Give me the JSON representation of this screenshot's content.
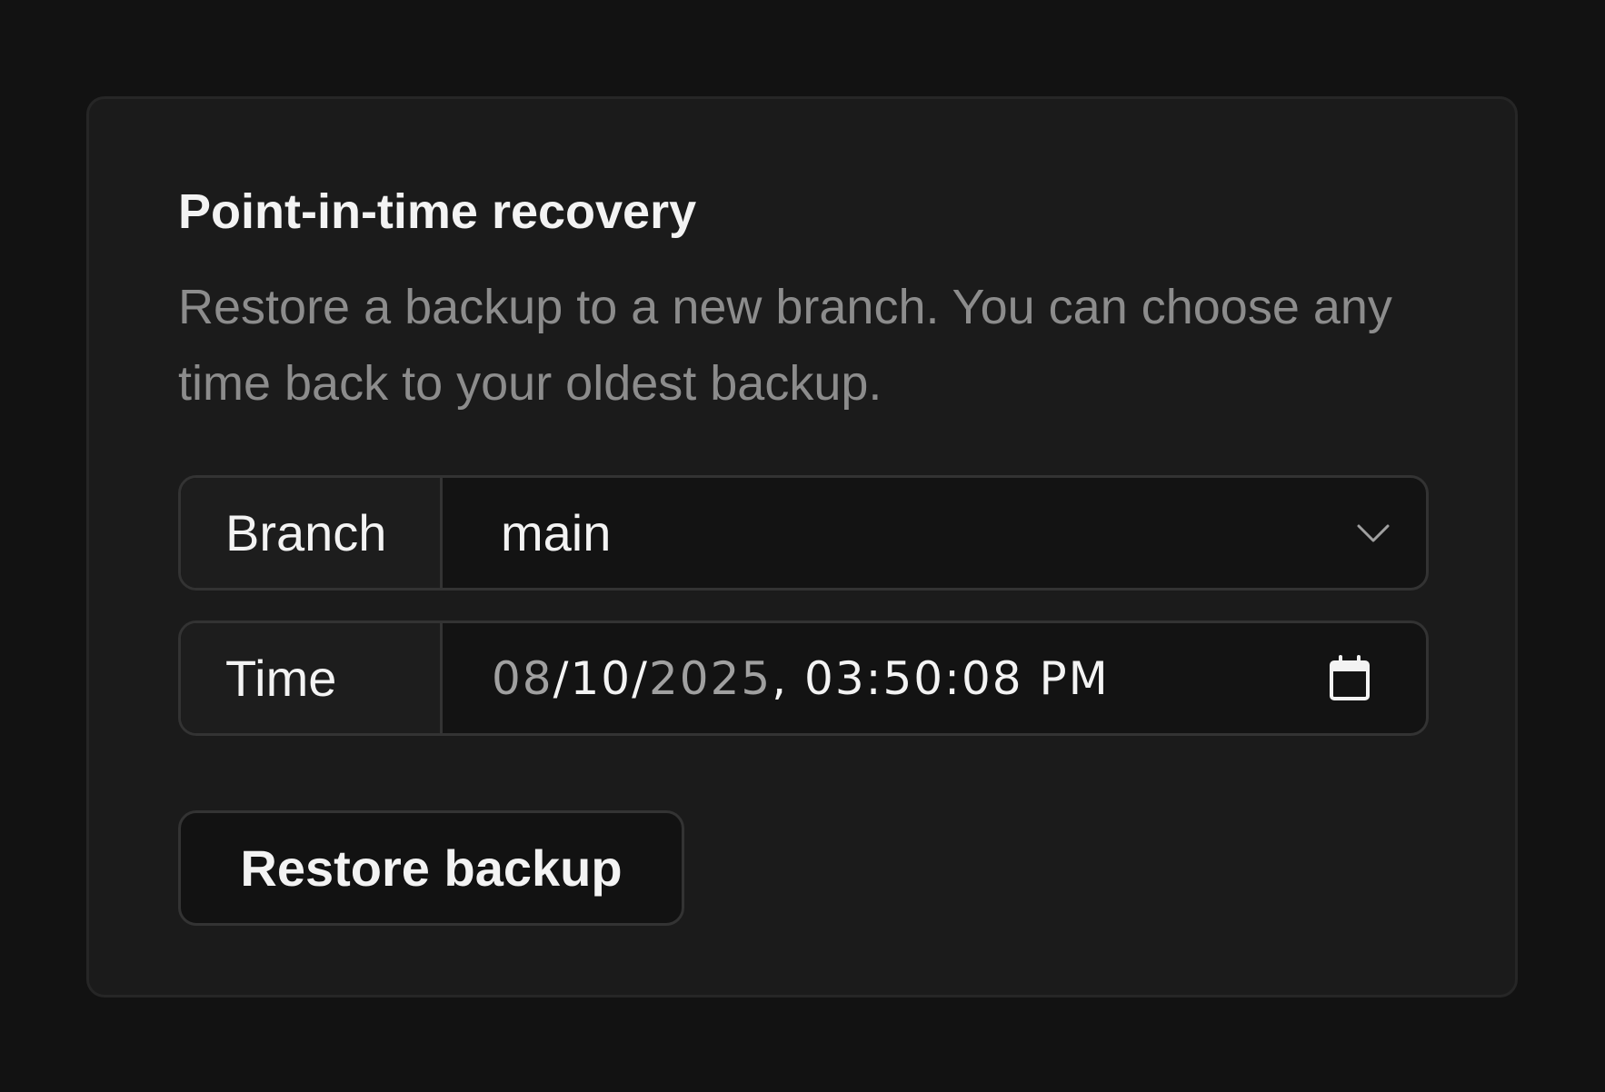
{
  "card": {
    "title": "Point-in-time recovery",
    "description": "Restore a backup to a new branch. You can choose any time back to your oldest backup."
  },
  "branch_field": {
    "label": "Branch",
    "value": "main",
    "icon": "chevron-down-icon"
  },
  "time_field": {
    "label": "Time",
    "month": "08",
    "day": "10",
    "year": "2025",
    "time": "03:50:08 PM",
    "icon": "calendar-icon"
  },
  "actions": {
    "restore_label": "Restore backup"
  },
  "colors": {
    "background": "#121212",
    "card": "#1b1b1b",
    "text": "#f3f3f3",
    "muted": "#8c8c8c",
    "border": "#333333"
  }
}
